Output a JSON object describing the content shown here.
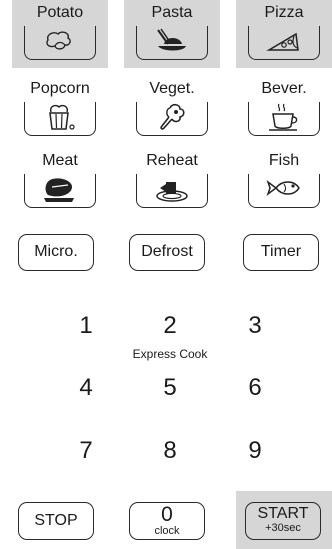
{
  "presets": {
    "potato": "Potato",
    "pasta": "Pasta",
    "pizza": "Pizza",
    "popcorn": "Popcorn",
    "veget": "Veget.",
    "bever": "Bever.",
    "meat": "Meat",
    "reheat": "Reheat",
    "fish": "Fish"
  },
  "modes": {
    "micro": "Micro.",
    "defrost": "Defrost",
    "timer": "Timer"
  },
  "keypad": {
    "d1": "1",
    "d2": "2",
    "d3": "3",
    "d4": "4",
    "d5": "5",
    "d6": "6",
    "d7": "7",
    "d8": "8",
    "d9": "9",
    "d2_sub": "Express Cook",
    "d0": "0",
    "d0_sub": "clock"
  },
  "actions": {
    "stop": "STOP",
    "start": "START",
    "start_sub": "+30sec"
  },
  "colors": {
    "shaded_button": "#d6d6d6",
    "outline": "#2a2a2a",
    "background": "#ffffff"
  }
}
